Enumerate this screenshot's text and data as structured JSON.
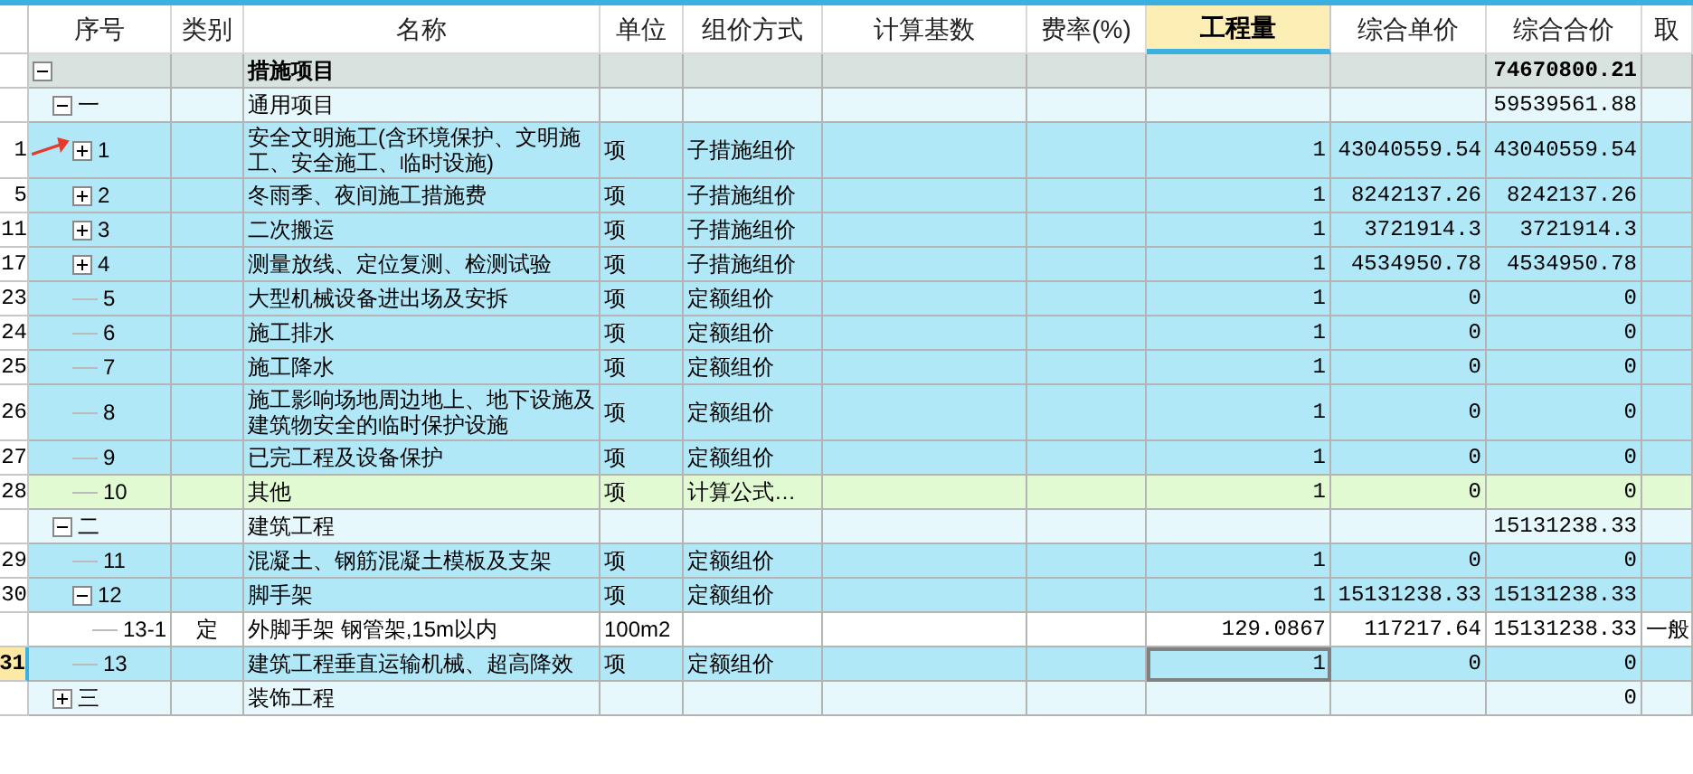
{
  "columns": [
    {
      "label": "序号",
      "selected": false
    },
    {
      "label": "类别",
      "selected": false
    },
    {
      "label": "名称",
      "selected": false
    },
    {
      "label": "单位",
      "selected": false
    },
    {
      "label": "组价方式",
      "selected": false
    },
    {
      "label": "计算基数",
      "selected": false
    },
    {
      "label": "费率(%)",
      "selected": false
    },
    {
      "label": "工程量",
      "selected": true
    },
    {
      "label": "综合单价",
      "selected": false
    },
    {
      "label": "综合合价",
      "selected": false
    },
    {
      "label": "取",
      "selected": false
    }
  ],
  "rows": [
    {
      "kind": "root",
      "expanded": true,
      "selected": false,
      "name": "措施项目",
      "total": "74670800.21",
      "children": [
        {
          "kind": "group",
          "expanded": true,
          "selected": false,
          "seq": "一",
          "name": "通用项目",
          "total": "59539561.88",
          "children": [
            {
              "kind": "item",
              "expanded": false,
              "selected": false,
              "row_no": "1",
              "seq": "1",
              "name": "安全文明施工(含环境保护、文明施工、安全施工、临时设施)",
              "unit": "项",
              "pricing": "子措施组价",
              "qty": "1",
              "unit_price": "43040559.54",
              "total": "43040559.54"
            },
            {
              "kind": "item",
              "expanded": false,
              "selected": false,
              "row_no": "5",
              "seq": "2",
              "name": "冬雨季、夜间施工措施费",
              "unit": "项",
              "pricing": "子措施组价",
              "qty": "1",
              "unit_price": "8242137.26",
              "total": "8242137.26"
            },
            {
              "kind": "item",
              "expanded": false,
              "selected": false,
              "row_no": "11",
              "seq": "3",
              "name": "二次搬运",
              "unit": "项",
              "pricing": "子措施组价",
              "qty": "1",
              "unit_price": "3721914.3",
              "total": "3721914.3"
            },
            {
              "kind": "item",
              "expanded": false,
              "selected": false,
              "row_no": "17",
              "seq": "4",
              "name": "测量放线、定位复测、检测试验",
              "unit": "项",
              "pricing": "子措施组价",
              "qty": "1",
              "unit_price": "4534950.78",
              "total": "4534950.78"
            },
            {
              "kind": "item",
              "selected": false,
              "row_no": "23",
              "seq": "5",
              "name": "大型机械设备进出场及安拆",
              "unit": "项",
              "pricing": "定额组价",
              "qty": "1",
              "unit_price": "0",
              "total": "0"
            },
            {
              "kind": "item",
              "selected": false,
              "row_no": "24",
              "seq": "6",
              "name": "施工排水",
              "unit": "项",
              "pricing": "定额组价",
              "qty": "1",
              "unit_price": "0",
              "total": "0"
            },
            {
              "kind": "item",
              "selected": false,
              "row_no": "25",
              "seq": "7",
              "name": "施工降水",
              "unit": "项",
              "pricing": "定额组价",
              "qty": "1",
              "unit_price": "0",
              "total": "0"
            },
            {
              "kind": "item",
              "selected": false,
              "row_no": "26",
              "seq": "8",
              "name": "施工影响场地周边地上、地下设施及建筑物安全的临时保护设施",
              "unit": "项",
              "pricing": "定额组价",
              "qty": "1",
              "unit_price": "0",
              "total": "0"
            },
            {
              "kind": "item",
              "selected": false,
              "row_no": "27",
              "seq": "9",
              "name": "已完工程及设备保护",
              "unit": "项",
              "pricing": "定额组价",
              "qty": "1",
              "unit_price": "0",
              "total": "0"
            },
            {
              "kind": "other",
              "selected": false,
              "row_no": "28",
              "seq": "10",
              "name": "其他",
              "unit": "项",
              "pricing": "计算公式…",
              "qty": "1",
              "unit_price": "0",
              "total": "0"
            }
          ]
        },
        {
          "kind": "group",
          "expanded": true,
          "selected": false,
          "seq": "二",
          "name": "建筑工程",
          "total": "15131238.33",
          "children": [
            {
              "kind": "item",
              "selected": false,
              "row_no": "29",
              "seq": "11",
              "name": "混凝土、钢筋混凝土模板及支架",
              "unit": "项",
              "pricing": "定额组价",
              "qty": "1",
              "unit_price": "0",
              "total": "0"
            },
            {
              "kind": "item",
              "expanded": true,
              "selected": false,
              "row_no": "30",
              "seq": "12",
              "name": "脚手架",
              "unit": "项",
              "pricing": "定额组价",
              "qty": "1",
              "unit_price": "15131238.33",
              "total": "15131238.33",
              "children": [
                {
                  "kind": "sub",
                  "selected": false,
                  "seq": "13-1",
                  "category": "定",
                  "name": "外脚手架 钢管架,15m以内",
                  "unit": "100m2",
                  "qty": "129.0867",
                  "unit_price": "117217.64",
                  "total": "15131238.33",
                  "col_12": "一般"
                }
              ]
            },
            {
              "kind": "item",
              "selected": true,
              "row_no": "31",
              "seq": "13",
              "name": "建筑工程垂直运输机械、超高降效",
              "unit": "项",
              "pricing": "定额组价",
              "qty": "1",
              "unit_price": "0",
              "total": "0"
            }
          ]
        },
        {
          "kind": "group",
          "expanded": false,
          "selected": false,
          "seq": "三",
          "name": "装饰工程",
          "total": "0"
        }
      ]
    }
  ]
}
